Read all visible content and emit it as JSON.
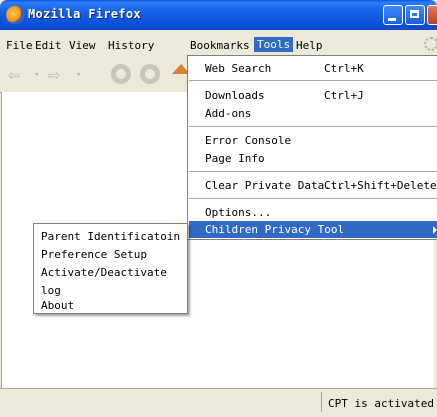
{
  "window": {
    "title": "Mozilla Firefox"
  },
  "menubar": {
    "items": [
      "File",
      "Edit",
      "View",
      "History",
      "Bookmarks",
      "Tools",
      "Help"
    ]
  },
  "tools_menu": {
    "items": [
      {
        "label": "Web Search",
        "shortcut": "Ctrl+K"
      },
      {
        "label": "Downloads",
        "shortcut": "Ctrl+J"
      },
      {
        "label": "Add-ons",
        "shortcut": ""
      },
      {
        "label": "Error Console",
        "shortcut": ""
      },
      {
        "label": "Page Info",
        "shortcut": ""
      },
      {
        "label": "Clear Private Data...",
        "shortcut": "Ctrl+Shift+Delete"
      },
      {
        "label": "Options...",
        "shortcut": ""
      },
      {
        "label": "Children Privacy Tool",
        "shortcut": ""
      }
    ]
  },
  "submenu": {
    "items": [
      "Parent Identificatoin",
      "Preference Setup",
      "Activate/Deactivate",
      "log",
      "About"
    ]
  },
  "statusbar": {
    "text": "CPT is activated"
  },
  "colors": {
    "title_bar": "#0b4fd6",
    "highlight": "#316ac5",
    "chrome": "#ece9d8"
  },
  "icons": [
    "firefox-logo-icon",
    "minimize-icon",
    "maximize-icon",
    "close-icon",
    "back-icon",
    "forward-icon",
    "reload-icon",
    "stop-icon",
    "home-icon",
    "throbber-icon",
    "submenu-arrow-icon"
  ]
}
